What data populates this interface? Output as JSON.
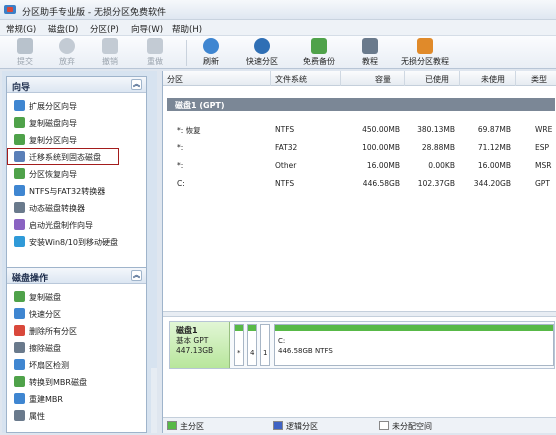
{
  "window": {
    "title": "分区助手专业版 - 无损分区免费软件"
  },
  "menu": [
    "常规(G)",
    "磁盘(D)",
    "分区(P)",
    "向导(W)",
    "帮助(H)"
  ],
  "toolbar": [
    {
      "label": "提交",
      "icon": "submit-icon",
      "enabled": false
    },
    {
      "label": "放弃",
      "icon": "discard-icon",
      "enabled": false
    },
    {
      "label": "撤销",
      "icon": "undo-icon",
      "enabled": false
    },
    {
      "label": "重做",
      "icon": "redo-icon",
      "enabled": false
    },
    {
      "label": "刷新",
      "icon": "refresh-icon",
      "enabled": true
    },
    {
      "label": "快速分区",
      "icon": "quick-partition-icon",
      "enabled": true
    },
    {
      "label": "免费备份",
      "icon": "free-backup-icon",
      "enabled": true
    },
    {
      "label": "教程",
      "icon": "tutorial-icon",
      "enabled": true
    },
    {
      "label": "无损分区教程",
      "icon": "lossless-tutorial-icon",
      "enabled": true
    }
  ],
  "wizard_panel": {
    "title": "向导",
    "items": [
      {
        "label": "扩展分区向导",
        "icon": "extend-icon",
        "color": "#3f86d1"
      },
      {
        "label": "复制磁盘向导",
        "icon": "copy-disk-icon",
        "color": "#4fa24a"
      },
      {
        "label": "复制分区向导",
        "icon": "copy-partition-icon",
        "color": "#4fa24a"
      },
      {
        "label": "迁移系统到固态磁盘",
        "icon": "migrate-ssd-icon",
        "color": "#5a7fb8"
      },
      {
        "label": "分区恢复向导",
        "icon": "recover-icon",
        "color": "#4fa24a"
      },
      {
        "label": "NTFS与FAT32转换器",
        "icon": "convert-icon",
        "color": "#3f86d1"
      },
      {
        "label": "动态磁盘转换器",
        "icon": "dynamic-disk-icon",
        "color": "#6a7a8c"
      },
      {
        "label": "启动光盘制作向导",
        "icon": "boot-disc-icon",
        "color": "#8a63c2"
      },
      {
        "label": "安装Win8/10到移动硬盘",
        "icon": "install-win-icon",
        "color": "#2f9ad8"
      }
    ]
  },
  "disk_ops_panel": {
    "title": "磁盘操作",
    "items": [
      {
        "label": "复制磁盘",
        "icon": "copy-disk-icon",
        "color": "#4fa24a"
      },
      {
        "label": "快速分区",
        "icon": "quick-partition-icon",
        "color": "#3f86d1"
      },
      {
        "label": "删除所有分区",
        "icon": "delete-all-icon",
        "color": "#d9483b"
      },
      {
        "label": "擦除磁盘",
        "icon": "wipe-icon",
        "color": "#6a7a8c"
      },
      {
        "label": "坏扇区检测",
        "icon": "bad-sector-icon",
        "color": "#3f86d1"
      },
      {
        "label": "转换到MBR磁盘",
        "icon": "mbr-icon",
        "color": "#4fa24a"
      },
      {
        "label": "重建MBR",
        "icon": "rebuild-mbr-icon",
        "color": "#3f86d1"
      },
      {
        "label": "属性",
        "icon": "properties-icon",
        "color": "#6a7a8c"
      }
    ]
  },
  "table": {
    "columns": [
      "分区",
      "文件系统",
      "容量",
      "已使用",
      "未使用",
      "类型"
    ],
    "disk_header": "磁盘1 (GPT)",
    "rows": [
      {
        "partition": "*: 恢复",
        "fs": "NTFS",
        "capacity": "450.00MB",
        "used": "380.13MB",
        "free": "69.87MB",
        "type": "WRE"
      },
      {
        "partition": "*:",
        "fs": "FAT32",
        "capacity": "100.00MB",
        "used": "28.88MB",
        "free": "71.12MB",
        "type": "ESP"
      },
      {
        "partition": "*:",
        "fs": "Other",
        "capacity": "16.00MB",
        "used": "0.00KB",
        "free": "16.00MB",
        "type": "MSR"
      },
      {
        "partition": "C:",
        "fs": "NTFS",
        "capacity": "446.58GB",
        "used": "102.37GB",
        "free": "344.20GB",
        "type": "GPT"
      }
    ]
  },
  "disk_map": {
    "name": "磁盘1",
    "type": "基本 GPT",
    "size": "447.13GB",
    "small_segments": [
      "*",
      "4",
      "1"
    ],
    "main_partition": {
      "label": "C:",
      "detail": "446.58GB NTFS"
    }
  },
  "legend": [
    {
      "label": "主分区",
      "color": "#58b947"
    },
    {
      "label": "逻辑分区",
      "color": "#3f63c4"
    },
    {
      "label": "未分配空间",
      "color": "#ffffff"
    }
  ]
}
